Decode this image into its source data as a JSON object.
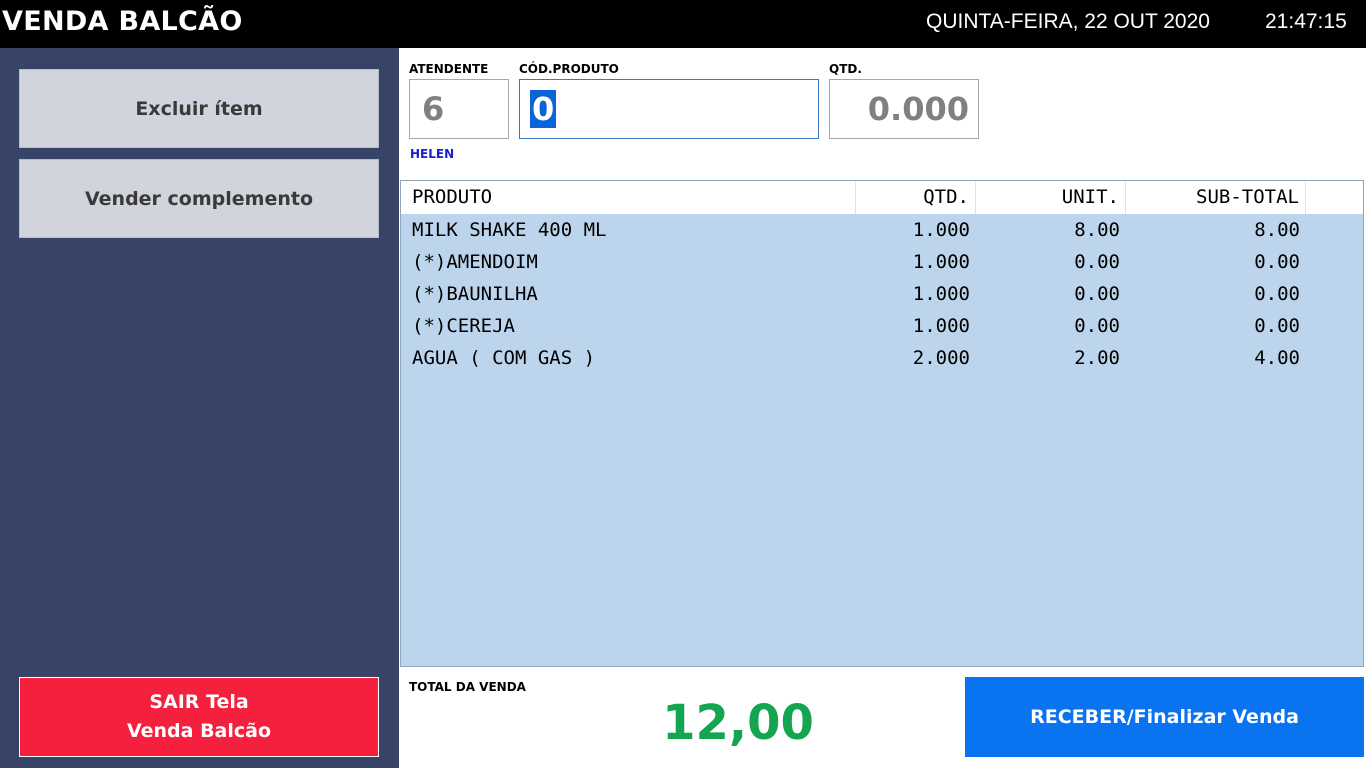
{
  "header": {
    "title": "VENDA BALCÃO",
    "date": "QUINTA-FEIRA, 22 OUT 2020",
    "time": "21:47:15"
  },
  "sidebar": {
    "excluir_label": "Excluir ítem",
    "complemento_label": "Vender complemento",
    "sair_line1": "SAIR Tela",
    "sair_line2": "Venda Balcão"
  },
  "form": {
    "atendente_label": "ATENDENTE",
    "atendente_value": "6",
    "atendente_name": "HELEN",
    "codigo_label": "CÓD.PRODUTO",
    "codigo_value": "0",
    "qtd_label": "QTD.",
    "qtd_value": "0.000"
  },
  "table": {
    "columns": [
      "PRODUTO",
      "QTD.",
      "UNIT.",
      "SUB-TOTAL"
    ],
    "rows": [
      {
        "produto": "MILK SHAKE 400 ML",
        "qtd": "1.000",
        "unit": "8.00",
        "subtotal": "8.00"
      },
      {
        "produto": "(*)AMENDOIM",
        "qtd": "1.000",
        "unit": "0.00",
        "subtotal": "0.00"
      },
      {
        "produto": "(*)BAUNILHA",
        "qtd": "1.000",
        "unit": "0.00",
        "subtotal": "0.00"
      },
      {
        "produto": "(*)CEREJA",
        "qtd": "1.000",
        "unit": "0.00",
        "subtotal": "0.00"
      },
      {
        "produto": "AGUA ( COM GAS )",
        "qtd": "2.000",
        "unit": "2.00",
        "subtotal": "4.00"
      }
    ]
  },
  "footer": {
    "total_label": "TOTAL DA VENDA",
    "total_value": "12,00",
    "receber_label": "RECEBER/Finalizar Venda"
  },
  "colors": {
    "sidebar_bg": "#374467",
    "grid_bg": "#bdd5ec",
    "total_green": "#13a550",
    "sair_red": "#f51f3e",
    "receber_blue": "#0a74f0"
  }
}
